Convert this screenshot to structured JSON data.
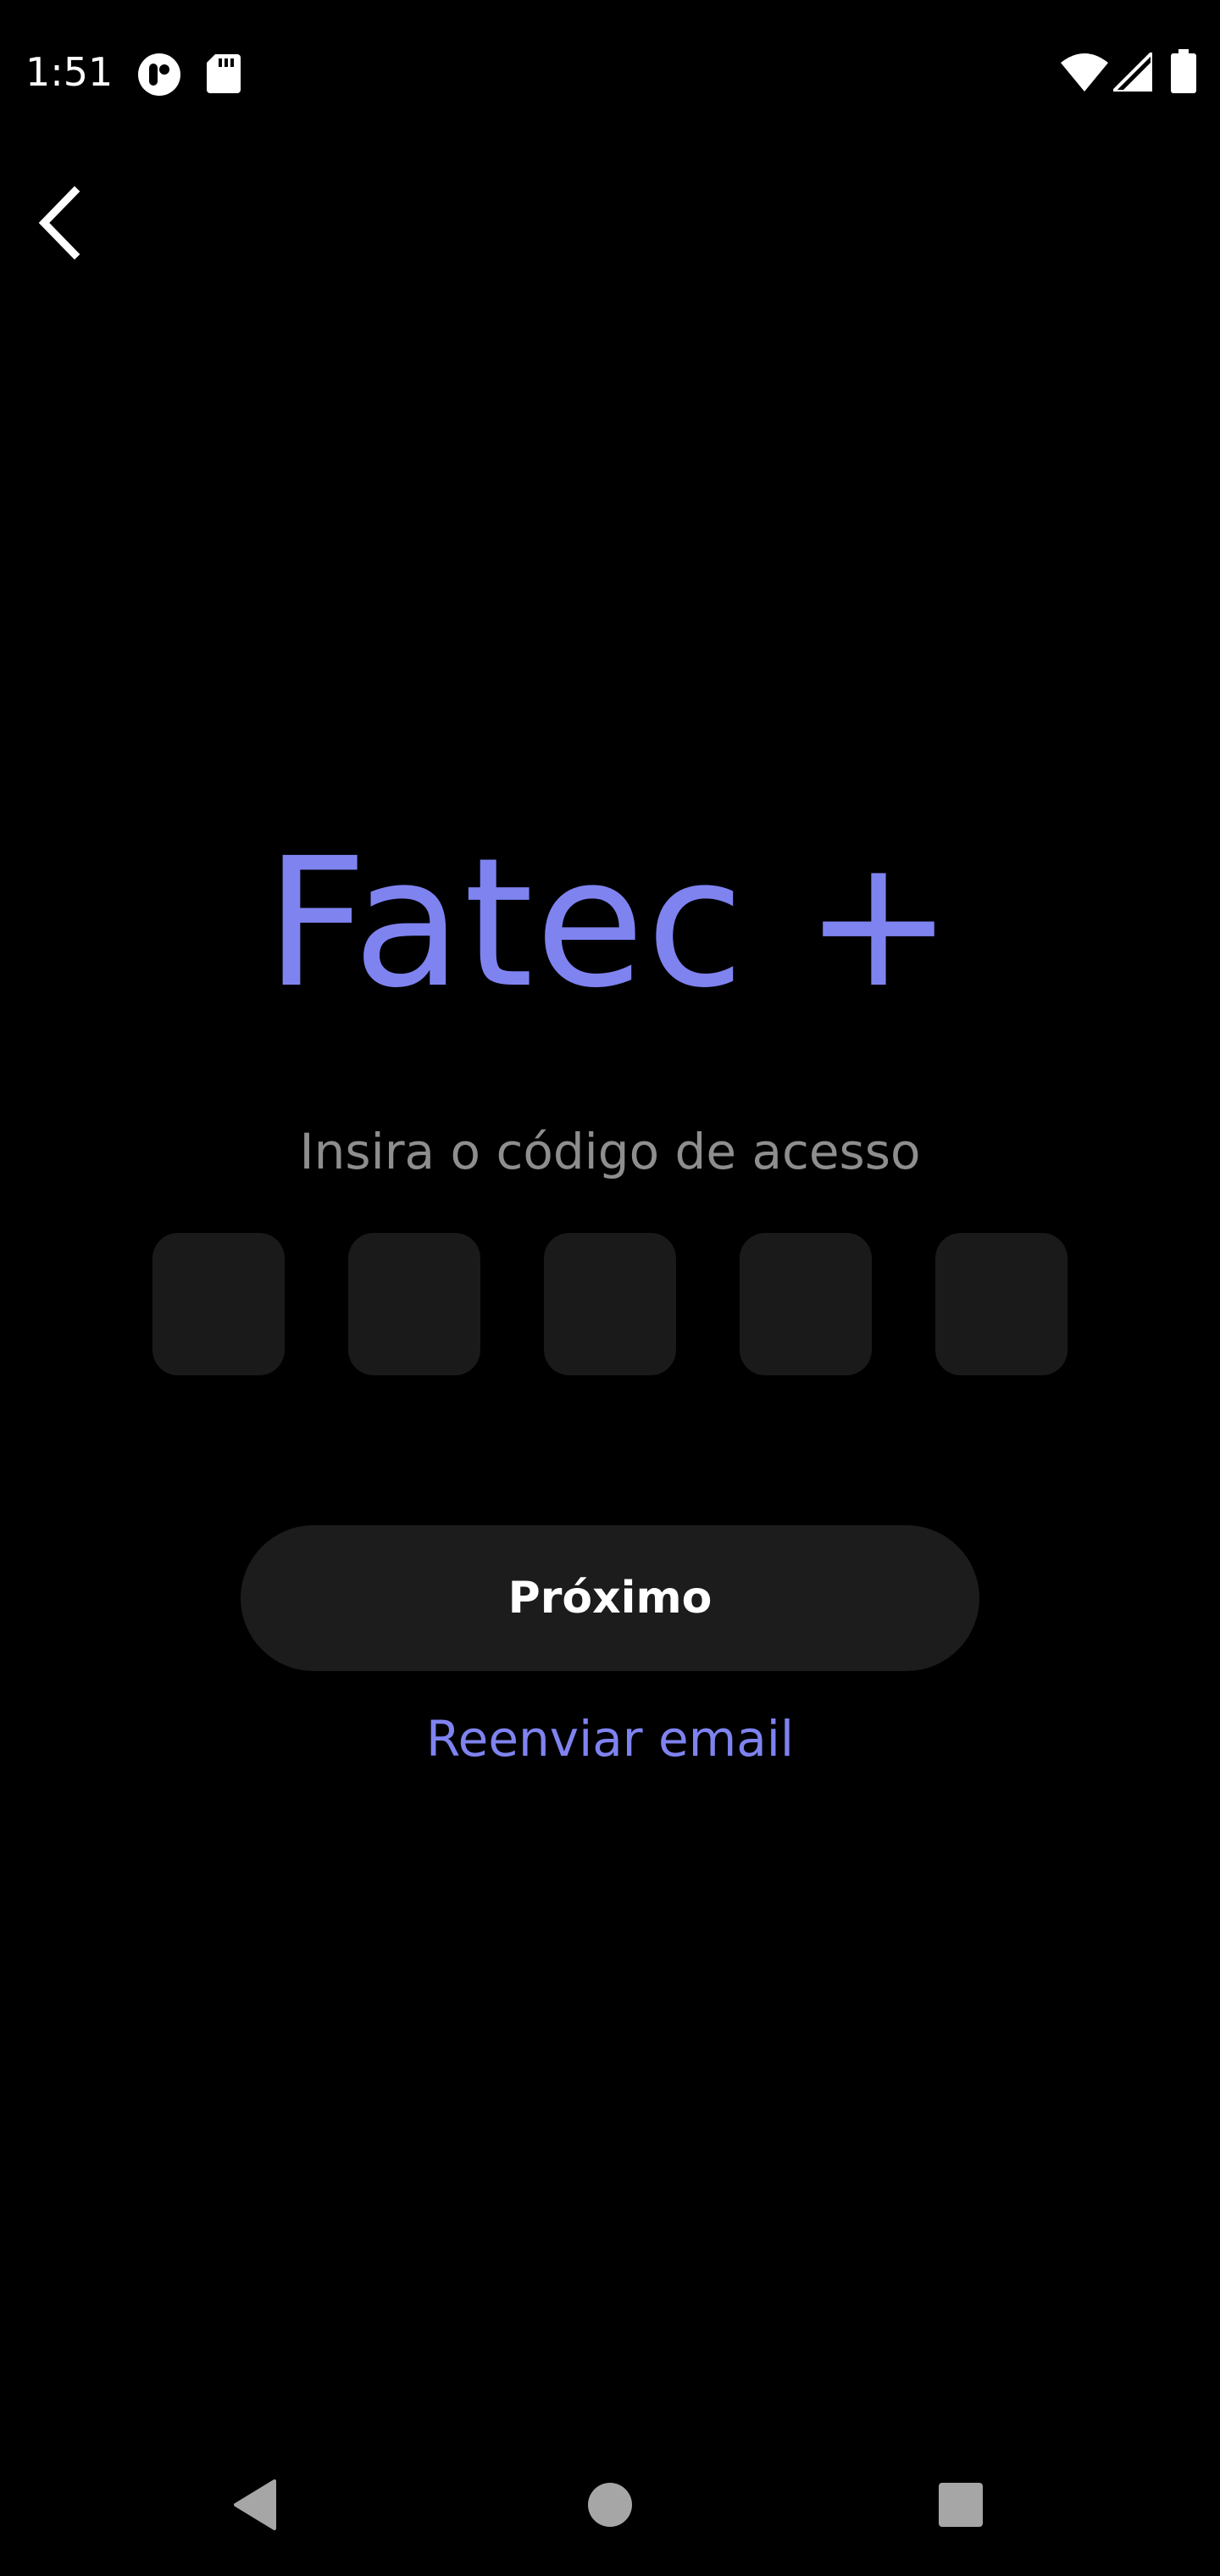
{
  "status_bar": {
    "time": "1:51",
    "icons": [
      "app-notification-icon",
      "sd-card-icon",
      "wifi-icon",
      "cell-signal-icon",
      "battery-icon"
    ]
  },
  "header": {
    "back_icon": "chevron-left-icon"
  },
  "logo": {
    "text": "Fatec +"
  },
  "form": {
    "subtitle": "Insira o código de acesso",
    "code_digits": [
      "",
      "",
      "",
      "",
      ""
    ],
    "next_label": "Próximo",
    "resend_label": "Reenviar email"
  },
  "nav_bar": {
    "icons": [
      "back-triangle-icon",
      "home-circle-icon",
      "recents-square-icon"
    ]
  },
  "colors": {
    "accent": "#7f83f0",
    "background": "#000000",
    "field": "#1a1a1a",
    "button": "#1c1c1c",
    "subtitle": "#8e8e8e"
  }
}
